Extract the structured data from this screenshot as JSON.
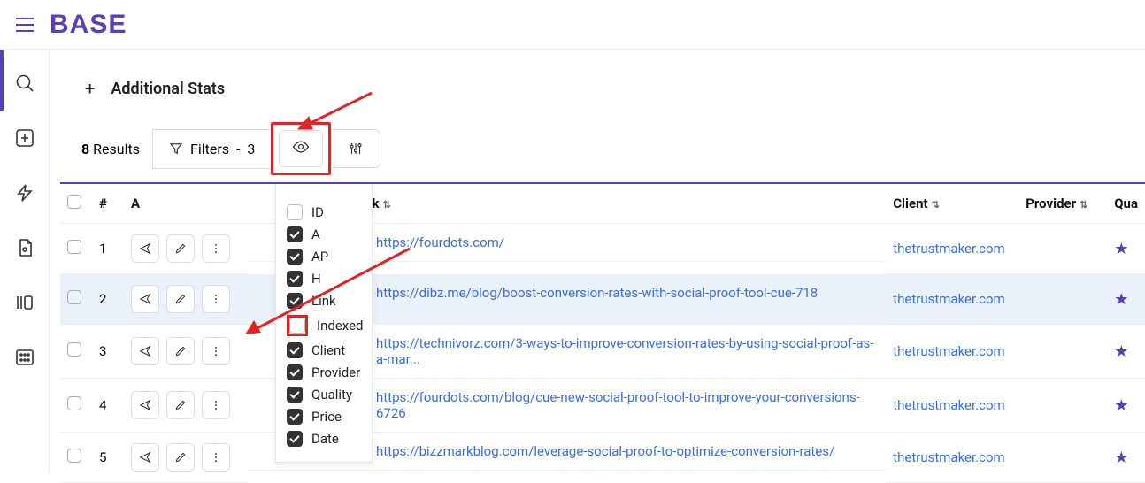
{
  "brand": "BASE",
  "additionalStats": "Additional Stats",
  "results": {
    "count": "8",
    "label": "Results"
  },
  "filters": {
    "label": "Filters",
    "count": "3"
  },
  "columns": {
    "hash": "#",
    "a": "A",
    "link": "Link",
    "client": "Client",
    "provider": "Provider",
    "quality": "Qua"
  },
  "dropdown": [
    {
      "label": "ID",
      "on": false
    },
    {
      "label": "A",
      "on": true
    },
    {
      "label": "AP",
      "on": true
    },
    {
      "label": "H",
      "on": true
    },
    {
      "label": "Link",
      "on": true
    },
    {
      "label": "Indexed",
      "on": false,
      "highlight": true
    },
    {
      "label": "Client",
      "on": true
    },
    {
      "label": "Provider",
      "on": true
    },
    {
      "label": "Quality",
      "on": true
    },
    {
      "label": "Price",
      "on": true
    },
    {
      "label": "Date",
      "on": true
    }
  ],
  "rows": [
    {
      "n": "1",
      "link": "https://fourdots.com/",
      "client": "thetrustmaker.com",
      "star": true,
      "hl": false
    },
    {
      "n": "2",
      "link": "https://dibz.me/blog/boost-conversion-rates-with-social-proof-tool-cue-718",
      "client": "thetrustmaker.com",
      "star": true,
      "hl": true
    },
    {
      "n": "3",
      "link": "https://technivorz.com/3-ways-to-improve-conversion-rates-by-using-social-proof-as-a-mar...",
      "client": "thetrustmaker.com",
      "star": true,
      "hl": false
    },
    {
      "n": "4",
      "link": "https://fourdots.com/blog/cue-new-social-proof-tool-to-improve-your-conversions-6726",
      "client": "thetrustmaker.com",
      "star": true,
      "hl": false
    },
    {
      "n": "5",
      "link": "https://bizzmarkblog.com/leverage-social-proof-to-optimize-conversion-rates/",
      "client": "thetrustmaker.com",
      "star": true,
      "hl": false
    }
  ]
}
